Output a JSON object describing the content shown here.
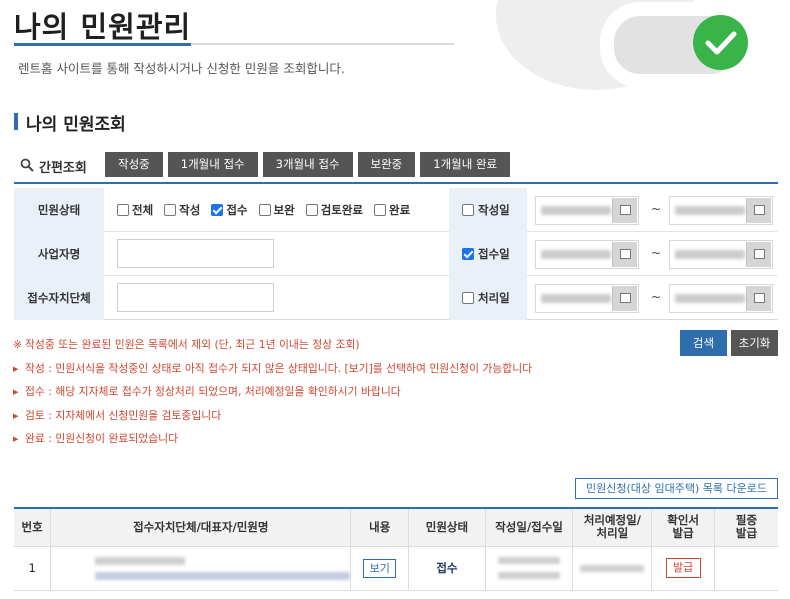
{
  "header": {
    "title": "나의 민원관리",
    "description": "렌트홈 사이트를 통해 작성하시거나 신청한 민원을 조회합니다."
  },
  "section": {
    "title": "나의 민원조회"
  },
  "quick_search": {
    "label": "간편조회",
    "buttons": [
      "작성중",
      "1개월내 접수",
      "3개월내 접수",
      "보완중",
      "1개월내 완료"
    ]
  },
  "filters": {
    "status_label": "민원상태",
    "status_options": [
      {
        "label": "전체",
        "checked": false
      },
      {
        "label": "작성",
        "checked": false
      },
      {
        "label": "접수",
        "checked": true
      },
      {
        "label": "보완",
        "checked": false
      },
      {
        "label": "검토완료",
        "checked": false
      },
      {
        "label": "완료",
        "checked": false
      }
    ],
    "business_label": "사업자명",
    "local_gov_label": "접수자치단체",
    "date_filters": [
      {
        "label": "작성일",
        "checked": false
      },
      {
        "label": "접수일",
        "checked": true
      },
      {
        "label": "처리일",
        "checked": false
      }
    ],
    "tilde": "~"
  },
  "actions": {
    "search": "검색",
    "reset": "초기화"
  },
  "notices": [
    {
      "marker": "※",
      "text": "작성중 또는 완료된 민원은 목록에서 제외 (단, 최근 1년 이내는 정상 조회)"
    },
    {
      "marker": "▸",
      "text": "작성 : 민원서식을 작성중인 상태로 아직 접수가 되지 않은 상태입니다. [보기]를 선택하여 민원신청이 가능합니다"
    },
    {
      "marker": "▸",
      "text": "접수 : 해당 지자체로 접수가 정상처리 되었으며, 처리예정일을 확인하시기 바랍니다"
    },
    {
      "marker": "▸",
      "text": "검토 : 지자체에서 신청민원을 검토중입니다"
    },
    {
      "marker": "▸",
      "text": "완료 : 민원신청이 완료되었습니다"
    }
  ],
  "download_button": "민원신청(대상 임대주택) 목록 다운로드",
  "table": {
    "headers": [
      "번호",
      "접수자치단체/대표자/민원명",
      "내용",
      "민원상태",
      "작성일/접수일",
      "처리예정일/\n처리일",
      "확인서\n발급",
      "필증\n발급"
    ],
    "rows": [
      {
        "no": "1",
        "content_button": "보기",
        "status": "접수",
        "issue_button": "발급"
      }
    ]
  },
  "colors": {
    "accent": "#2e6dae",
    "notice": "#d1462f",
    "success": "#38b449"
  }
}
